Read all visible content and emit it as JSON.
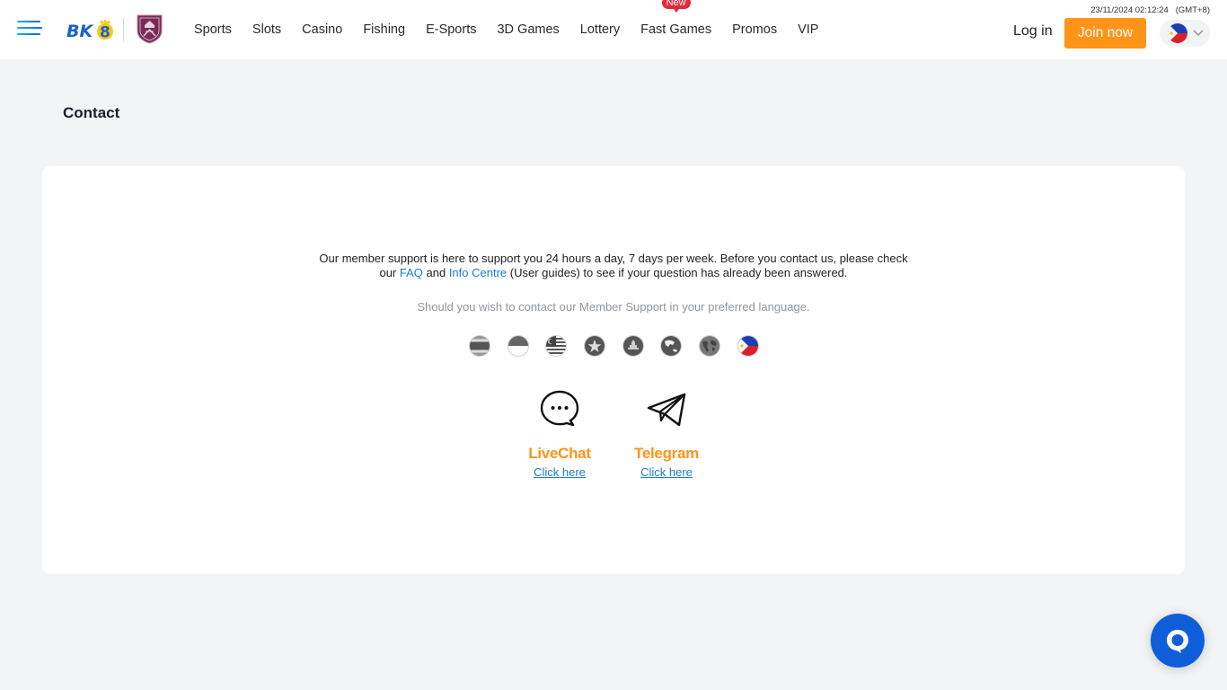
{
  "header": {
    "logo_text": "BK8",
    "nav": [
      {
        "label": "Sports"
      },
      {
        "label": "Slots"
      },
      {
        "label": "Casino"
      },
      {
        "label": "Fishing"
      },
      {
        "label": "E-Sports"
      },
      {
        "label": "3D Games"
      },
      {
        "label": "Lottery"
      },
      {
        "label": "Fast Games",
        "badge": "New"
      },
      {
        "label": "Promos"
      },
      {
        "label": "VIP"
      }
    ],
    "datetime": "23/11/2024 02:12:24",
    "timezone": "(GMT+8)",
    "login_label": "Log in",
    "join_label": "Join now",
    "language_icon": "philippines-flag-icon",
    "colors": {
      "accent": "#ff9419",
      "badge": "#e02a3b",
      "link": "#1a7cd6"
    }
  },
  "page": {
    "title": "Contact"
  },
  "contact": {
    "intro_line1": "Our member support is here to support you 24 hours a day, 7 days per week. Before you contact us, please check",
    "intro_line2_prefix": "our ",
    "faq_link": "FAQ",
    "and_text": " and ",
    "info_link": "Info Centre",
    "intro_line2_suffix": " (User guides) to see if your question has already been answered.",
    "language_note": "Should you wish to contact our Member Support in your preferred language.",
    "language_flags": [
      {
        "name": "thailand-flag-icon"
      },
      {
        "name": "indonesia-flag-icon"
      },
      {
        "name": "malaysia-flag-icon"
      },
      {
        "name": "vietnam-flag-icon"
      },
      {
        "name": "cambodia-flag-icon"
      },
      {
        "name": "asia-globe-icon"
      },
      {
        "name": "world-globe-icon"
      },
      {
        "name": "philippines-flag-icon"
      }
    ],
    "channels": [
      {
        "name": "LiveChat",
        "link": "Click here",
        "icon": "chat-bubble-icon"
      },
      {
        "name": "Telegram",
        "link": "Click here",
        "icon": "paper-plane-icon"
      }
    ]
  },
  "floating_chat": {
    "icon": "livechat-icon",
    "color": "#0d5ed8"
  }
}
